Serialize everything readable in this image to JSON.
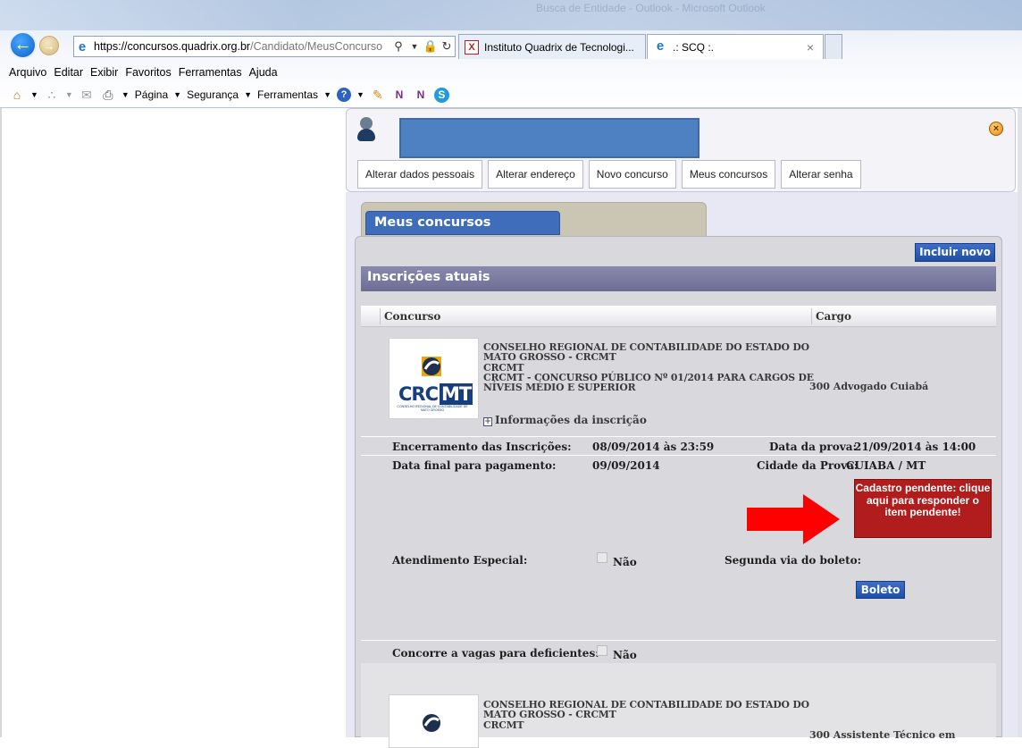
{
  "browser": {
    "window_title": "Busca de Entidade - Outlook - Microsoft Outlook",
    "url_host": "https://concursos.quadrix.org.br",
    "url_path": "/Candidato/MeusConcurso",
    "tabs": [
      {
        "label": "Instituto Quadrix de Tecnologi...",
        "icon": "quadrix-x-icon"
      },
      {
        "label": ".: SCQ :.",
        "icon": "ie-icon"
      }
    ],
    "menu": [
      "Arquivo",
      "Editar",
      "Exibir",
      "Favoritos",
      "Ferramentas",
      "Ajuda"
    ],
    "commands": {
      "pagina": "Página",
      "seguranca": "Segurança",
      "ferramentas": "Ferramentas"
    }
  },
  "user_panel": {
    "nav": [
      "Alterar dados pessoais",
      "Alterar endereço",
      "Novo concurso",
      "Meus concursos",
      "Alterar senha"
    ]
  },
  "page": {
    "tab_title": "Meus concursos",
    "incluir_label": "Incluir novo",
    "section_title": "Inscrições atuais",
    "columns": {
      "concurso": "Concurso",
      "cargo": "Cargo"
    }
  },
  "entry1": {
    "line1": "CONSELHO REGIONAL DE CONTABILIDADE DO ESTADO DO",
    "line2": "MATO GROSSO - CRCMT",
    "line3": "CRCMT",
    "line4": "CRCMT - CONCURSO PÚBLICO Nº 01/2014 PARA CARGOS DE",
    "line5": "NÍVEIS MÉDIO E SUPERIOR",
    "cargo": "300 Advogado Cuiabá",
    "info_link": "Informações da inscrição",
    "logo": {
      "crc": "CRC",
      "mt": "MT",
      "sub": "CONSELHO REGIONAL DE CONTABILIDADE DE MATO GROSSO"
    },
    "encerramento_label": "Encerramento das Inscrições:",
    "encerramento_value": "08/09/2014 às 23:59",
    "data_prova_label": "Data da prova:",
    "data_prova_value": "21/09/2014 às 14:00",
    "pagamento_label": "Data final para pagamento:",
    "pagamento_value": "09/09/2014",
    "cidade_label": "Cidade da Prova:",
    "cidade_value": "CUIABA / MT",
    "pendente": "Cadastro pendente: clique aqui para responder o item pendente!",
    "atendimento_label": "Atendimento Especial:",
    "atendimento_value": "Não",
    "segunda_via_label": "Segunda via do boleto:",
    "boleto_label": "Boleto",
    "deficientes_label": "Concorre a vagas para deficientes:",
    "deficientes_value": "Não"
  },
  "entry2": {
    "line1": "CONSELHO REGIONAL DE CONTABILIDADE DO ESTADO DO",
    "line2": "MATO GROSSO - CRCMT",
    "line3": "CRCMT",
    "cargo": "300 Assistente Técnico em"
  },
  "colors": {
    "accent": "#3f6dbb",
    "pending": "#b11d1d",
    "arrow": "#ff0000",
    "header": "#7a7aa0"
  }
}
